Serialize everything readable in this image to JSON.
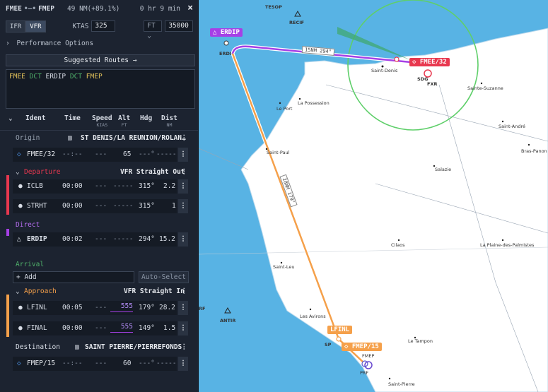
{
  "header": {
    "from": "FMEE",
    "to": "FMEP",
    "distance": "49 NM(+89.1%)",
    "time": "0 hr 9 min",
    "close": "×"
  },
  "controls": {
    "ifr": "IFR",
    "vfr": "VFR",
    "ktas_label": "KTAS",
    "ktas_value": "325",
    "alt_unit": "FT",
    "alt_value": "35000"
  },
  "perf_options": "Performance Options",
  "suggested_routes": "Suggested Routes →",
  "route": {
    "t1": "FMEE",
    "t2": "DCT",
    "t3": "ERDIP",
    "t4": "DCT",
    "t5": "FMEP"
  },
  "columns": {
    "ident": "Ident",
    "time": "Time",
    "speed": "Speed",
    "speed_unit": "KIAS",
    "alt": "Alt",
    "alt_unit": "FT",
    "hdg": "Hdg",
    "dist": "Dist",
    "dist_unit": "NM"
  },
  "origin": {
    "label": "Origin",
    "name": "ST DENIS/LA REUNION/ROLAN…",
    "ident": "FMEE/32",
    "time": "--:--",
    "speed": "---",
    "alt": "65",
    "hdg": "---°",
    "dist": "-----"
  },
  "departure": {
    "label": "Departure",
    "proc": "VFR Straight Out",
    "rows": [
      {
        "ident": "ICLB",
        "time": "00:00",
        "speed": "---",
        "alt": "-----",
        "hdg": "315°",
        "dist": "2.2"
      },
      {
        "ident": "STRHT",
        "time": "00:00",
        "speed": "---",
        "alt": "-----",
        "hdg": "315°",
        "dist": "1"
      }
    ]
  },
  "direct": {
    "label": "Direct",
    "ident": "ERDIP",
    "time": "00:02",
    "speed": "---",
    "alt": "-----",
    "hdg": "294°",
    "dist": "15.2"
  },
  "arrival": {
    "label": "Arrival",
    "add": "+ Add",
    "auto": "Auto-Select"
  },
  "approach": {
    "label": "Approach",
    "proc": "VFR Straight In",
    "rows": [
      {
        "ident": "LFINL",
        "time": "00:05",
        "speed": "---",
        "alt": "555",
        "hdg": "179°",
        "dist": "28.2"
      },
      {
        "ident": "FINAL",
        "time": "00:00",
        "speed": "---",
        "alt": "555",
        "hdg": "149°",
        "dist": "1.5"
      }
    ]
  },
  "destination": {
    "label": "Destination",
    "name": "SAINT PIERRE/PIERREFONDS",
    "ident": "FMEP/15",
    "time": "--:--",
    "speed": "---",
    "alt": "60",
    "hdg": "---°",
    "dist": "-----"
  },
  "map": {
    "places": [
      "TESOP",
      "RECIF",
      "Saint-Denis",
      "Sainte-Suzanne",
      "Le Port",
      "La Possession",
      "Saint-André",
      "Bras-Panon",
      "Saint-Paul",
      "Salazie",
      "Cilaos",
      "La Plaine-des-Palmistes",
      "Saint-Leu",
      "Les Avirons",
      "ANTIR",
      "Le Tampon",
      "SP",
      "FMEP",
      "PRF",
      "SDG",
      "FXR",
      "ERDI",
      "RF",
      "Saint-Pierre"
    ],
    "leg1": "15NM 294°",
    "leg2": "28NM 179°",
    "tags": {
      "erdip": "ERDIP",
      "fmee": "FMEE/32",
      "lfinl": "LFINL",
      "fmep": "FMEP/15"
    }
  },
  "colors": {
    "panel": "#1c2330",
    "water": "#58b3e4",
    "land": "#ffffff",
    "direct": "#a640e6",
    "approach": "#f5a04a",
    "origin": "#e8384f",
    "circle": "#5fcf6a"
  }
}
